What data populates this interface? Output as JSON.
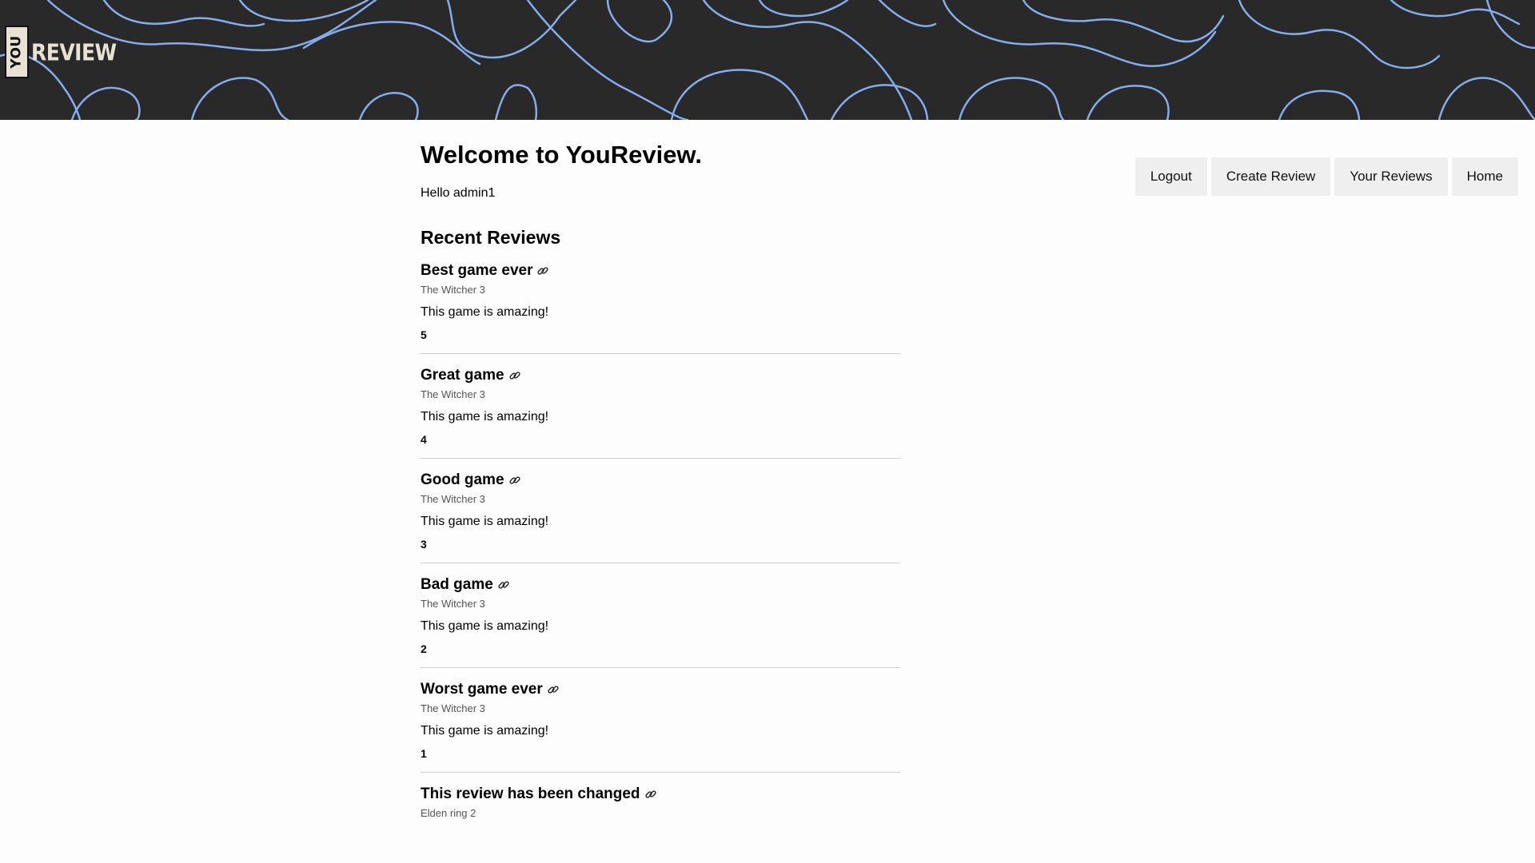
{
  "brand": {
    "logo_you": "YOU",
    "logo_review": "REVIEW",
    "accent": "#8ab4f8",
    "header_bg": "#292929"
  },
  "nav": {
    "logout": "Logout",
    "create_review": "Create Review",
    "your_reviews": "Your Reviews",
    "home": "Home"
  },
  "main": {
    "title": "Welcome to YouReview.",
    "greeting": "Hello admin1",
    "section_title": "Recent Reviews"
  },
  "reviews": [
    {
      "title": "Best game ever",
      "game": "The Witcher 3",
      "body": "This game is amazing!",
      "score": "5"
    },
    {
      "title": "Great game",
      "game": "The Witcher 3",
      "body": "This game is amazing!",
      "score": "4"
    },
    {
      "title": "Good game",
      "game": "The Witcher 3",
      "body": "This game is amazing!",
      "score": "3"
    },
    {
      "title": "Bad game",
      "game": "The Witcher 3",
      "body": "This game is amazing!",
      "score": "2"
    },
    {
      "title": "Worst game ever",
      "game": "The Witcher 3",
      "body": "This game is amazing!",
      "score": "1"
    },
    {
      "title": "This review has been changed",
      "game": "Elden ring 2",
      "body": "",
      "score": ""
    }
  ],
  "icons": {
    "review_link": "link-icon"
  }
}
